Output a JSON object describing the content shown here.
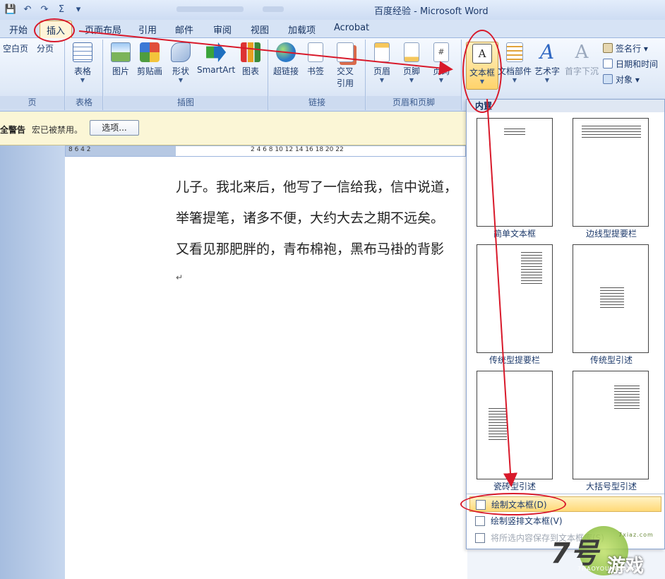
{
  "window": {
    "title": "百度经验 - Microsoft Word",
    "qat_icons": [
      "save-icon",
      "undo-icon",
      "redo-icon",
      "sum-icon",
      "customize-icon"
    ],
    "qat_glyphs": [
      "💾",
      "↶",
      "↷",
      "Σ",
      "▾"
    ]
  },
  "tabs": [
    "开始",
    "插入",
    "页面布局",
    "引用",
    "邮件",
    "审阅",
    "视图",
    "加载项",
    "Acrobat"
  ],
  "ribbon": {
    "pages": {
      "label": "页",
      "cover": "空白页",
      "break": "分页"
    },
    "tables": {
      "label": "表格",
      "table": "表格"
    },
    "illustrations": {
      "label": "插图",
      "picture": "图片",
      "clipart": "剪贴画",
      "shapes": "形状",
      "smartart": "SmartArt",
      "chart": "图表"
    },
    "links": {
      "label": "链接",
      "hyperlink": "超链接",
      "bookmark": "书签",
      "xref_1": "交叉",
      "xref_2": "引用"
    },
    "header_footer": {
      "label": "页眉和页脚",
      "header": "页眉",
      "footer": "页脚",
      "pagenum": "页码",
      "pagenum_glyph": "#"
    },
    "text": {
      "textbox": "文本框",
      "textbox_glyph": "A",
      "quickparts": "文档部件",
      "wordart": "艺术字",
      "wordart_glyph": "A",
      "dropcap": "首字下沉",
      "dropcap_glyph": "A"
    },
    "side": {
      "signature": "签名行",
      "datetime": "日期和时间",
      "object": "对象"
    }
  },
  "message_bar": {
    "warning": "全警告",
    "text": "宏已被禁用。",
    "options_button": "选项..."
  },
  "ruler": {
    "left": "8  6  4  2",
    "right": "2  4  6  8  10  12  14  16  18  20  22"
  },
  "document": {
    "lines": [
      "儿子。我北来后，他写了一信给我，信中说道，",
      "举箸提笔，诸多不便，大约大去之期不远矣。",
      "又看见那肥胖的，青布棉袍，黑布马褂的背影"
    ],
    "return_mark": "↵"
  },
  "gallery": {
    "section": "内置",
    "items": [
      "简单文本框",
      "边线型提要栏",
      "传统型提要栏",
      "传统型引述",
      "瓷砖型引述",
      "大括号型引述"
    ],
    "menu": [
      "绘制文本框(D)",
      "绘制竖排文本框(V)",
      "将所选内容保存到文本框库(S)"
    ]
  },
  "watermark": {
    "number": "7号",
    "brand": "游戏",
    "pinyin": "7HAOYOUXIWANG",
    "site": "7xiaz.com"
  },
  "colors": {
    "annotation": "#d8192a",
    "highlight": "#ffd977",
    "ribbon": "#dfe9f7"
  }
}
